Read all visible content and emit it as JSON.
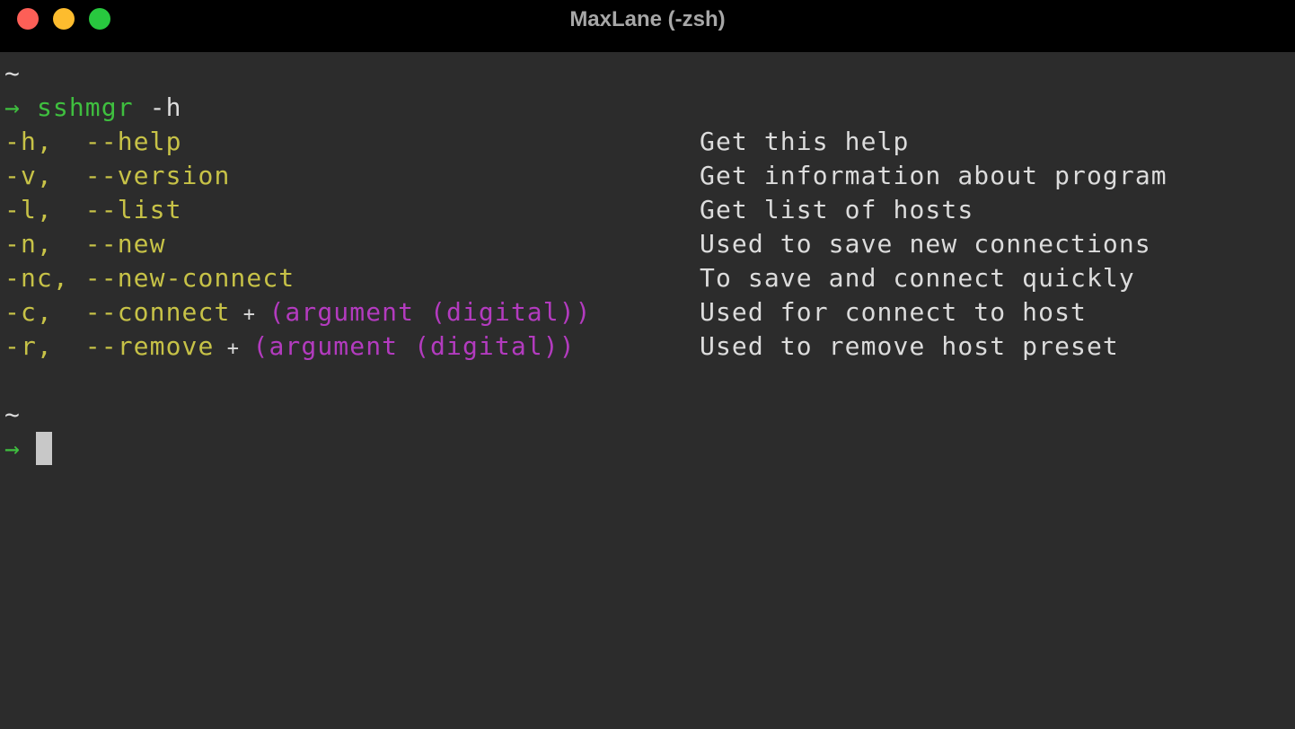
{
  "window": {
    "title": "MaxLane (-zsh)",
    "colors": {
      "close": "#fd5f57",
      "minimize": "#fdbc2e",
      "maximize": "#28c83f"
    }
  },
  "terminal": {
    "prompt_dir_1": "~",
    "prompt_arrow": "→",
    "command_name": "sshmgr",
    "command_args": " -h",
    "options": [
      {
        "short": "-h,",
        "long": "  --help",
        "plus": "",
        "arg": "",
        "desc": "Get this help"
      },
      {
        "short": "-v,",
        "long": "  --version",
        "plus": "",
        "arg": "",
        "desc": "Get information about program"
      },
      {
        "short": "-l,",
        "long": "  --list",
        "plus": "",
        "arg": "",
        "desc": "Get list of hosts"
      },
      {
        "short": "-n,",
        "long": "  --new",
        "plus": "",
        "arg": "",
        "desc": "Used to save new connections"
      },
      {
        "short": "-nc,",
        "long": " --new-connect",
        "plus": "",
        "arg": "",
        "desc": "To save and connect quickly"
      },
      {
        "short": "-c,",
        "long": "  --connect",
        "plus": " + ",
        "arg": "(argument (digital))",
        "desc": "Used for connect to host"
      },
      {
        "short": "-r,",
        "long": "  --remove",
        "plus": " + ",
        "arg": "(argument (digital))",
        "desc": "Used to remove host preset"
      }
    ],
    "prompt_dir_2": "~",
    "colors": {
      "prompt": "#3fbf3f",
      "flag": "#c7c247",
      "argument": "#b33bbf",
      "text": "#dcdcdc",
      "background": "#2c2c2c"
    }
  }
}
